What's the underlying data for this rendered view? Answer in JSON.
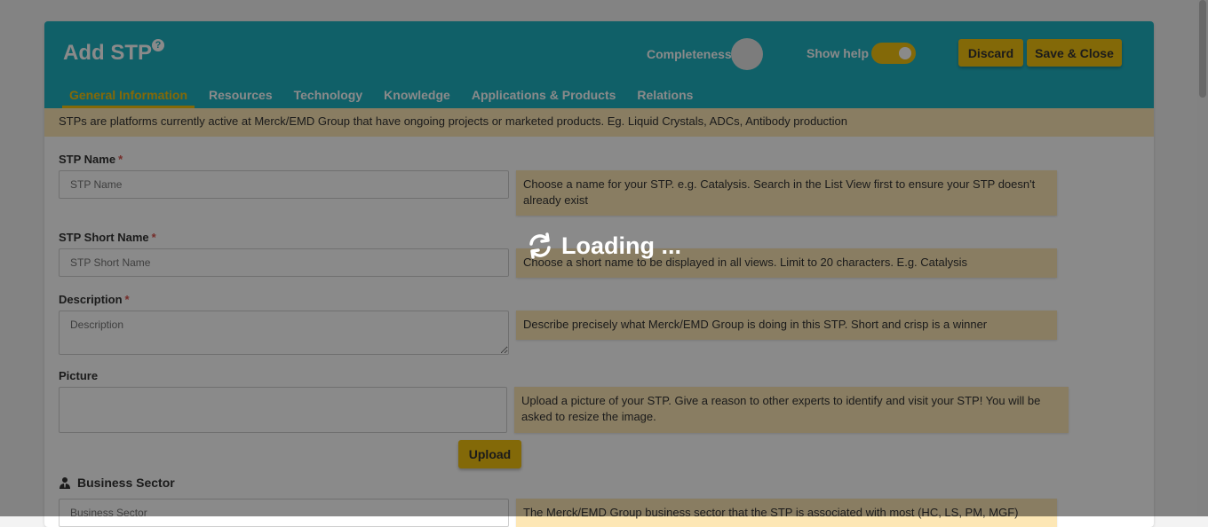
{
  "header": {
    "title": "Add STP",
    "help_icon": "question-circle-icon",
    "completeness_label": "Completeness",
    "show_help_label": "Show help",
    "show_help_on": true,
    "discard_label": "Discard",
    "save_close_label": "Save & Close"
  },
  "tabs": [
    {
      "label": "General Information",
      "active": true
    },
    {
      "label": "Resources",
      "active": false
    },
    {
      "label": "Technology",
      "active": false
    },
    {
      "label": "Knowledge",
      "active": false
    },
    {
      "label": "Applications & Products",
      "active": false
    },
    {
      "label": "Relations",
      "active": false
    }
  ],
  "banner": "STPs are platforms currently active at Merck/EMD Group that have ongoing projects or marketed products. Eg. Liquid Crystals, ADCs, Antibody production",
  "fields": {
    "stp_name": {
      "label": "STP Name",
      "required": "*",
      "placeholder": "STP Name",
      "hint": "Choose a name for your STP. e.g. Catalysis. Search in the List View first to ensure your STP doesn't already exist"
    },
    "stp_short_name": {
      "label": "STP Short Name",
      "required": "*",
      "placeholder": "STP Short Name",
      "hint": "Choose a short name to be displayed in all views. Limit to 20 characters. E.g. Catalysis"
    },
    "description": {
      "label": "Description",
      "required": "*",
      "placeholder": "Description",
      "hint": "Describe precisely what Merck/EMD Group is doing in this STP. Short and crisp is a winner"
    },
    "picture": {
      "label": "Picture",
      "hint": "Upload a picture of your STP. Give a reason to other experts to identify and visit your STP! You will be asked to resize the image.",
      "upload_label": "Upload"
    },
    "business_sector": {
      "label": "Business Sector",
      "icon": "user-tie-icon",
      "placeholder": "Business Sector",
      "hint": "The Merck/EMD Group business sector that the STP is associated with most (HC, LS, PM, MGF)"
    }
  },
  "overlay": {
    "loading_text": "Loading ...",
    "icon": "refresh-icon"
  },
  "colors": {
    "header": "#1fb1c1",
    "accent": "#f3c20f",
    "hint_bg": "#fde7b5"
  }
}
